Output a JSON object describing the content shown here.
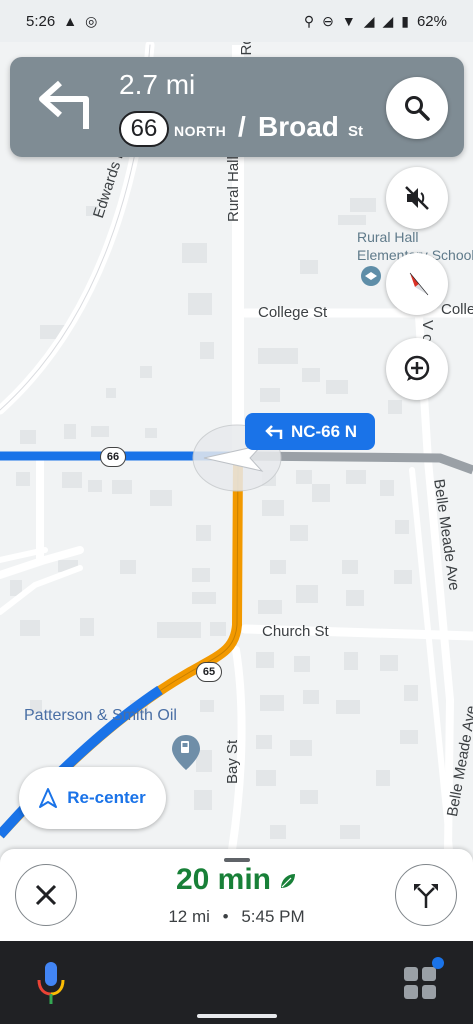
{
  "status_bar": {
    "time": "5:26",
    "battery": "62%"
  },
  "navigation": {
    "distance": "2.7 mi",
    "route_number": "66",
    "direction": "NORTH",
    "separator": "/",
    "street": "Broad",
    "street_suffix": "St"
  },
  "map": {
    "callout_label": "NC-66 N",
    "route_shields": [
      "66",
      "65"
    ],
    "streets": {
      "edwards": "Edwards Rd",
      "rural_hall": "Rural Hall",
      "rural_hall_top": "n Rd",
      "college": "College St",
      "college_right": "Colle",
      "church": "Church St",
      "bay": "Bay St",
      "belle_meade_1": "Belle Meade Ave",
      "belle_meade_2": "Belle Meade Ave",
      "vernon": "V      on St"
    },
    "pois": {
      "school": "Rural Hall\nElementary School",
      "gas": "Patterson & Smith Oil"
    }
  },
  "buttons": {
    "recenter": "Re-center"
  },
  "trip": {
    "duration": "20 min",
    "distance": "12 mi",
    "separator": "•",
    "arrival": "5:45 PM"
  },
  "colors": {
    "route_blue": "#1a73e8",
    "route_orange": "#f29900",
    "eta_green": "#188038",
    "nav_card": "#7f8c94"
  }
}
